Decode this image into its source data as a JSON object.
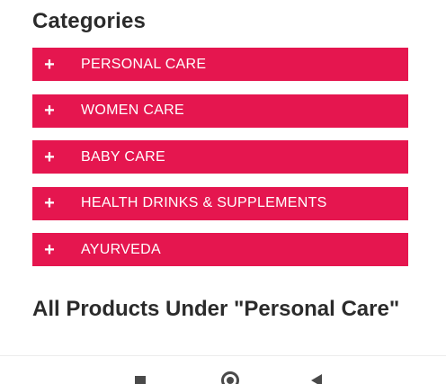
{
  "categories": {
    "title": "Categories",
    "items": [
      {
        "icon": "+",
        "label": "PERSONAL CARE"
      },
      {
        "icon": "+",
        "label": "WOMEN CARE"
      },
      {
        "icon": "+",
        "label": "BABY CARE"
      },
      {
        "icon": "+",
        "label": "HEALTH DRINKS & SUPPLEMENTS"
      },
      {
        "icon": "+",
        "label": "AYURVEDA"
      }
    ]
  },
  "products": {
    "title": "All Products Under \"Personal Care\""
  },
  "navbar": {
    "icons": [
      "recents-square-icon",
      "home-circle-icon",
      "back-triangle-icon"
    ]
  },
  "colors": {
    "accent": "#e5164f",
    "heading": "#2b2b2b"
  }
}
